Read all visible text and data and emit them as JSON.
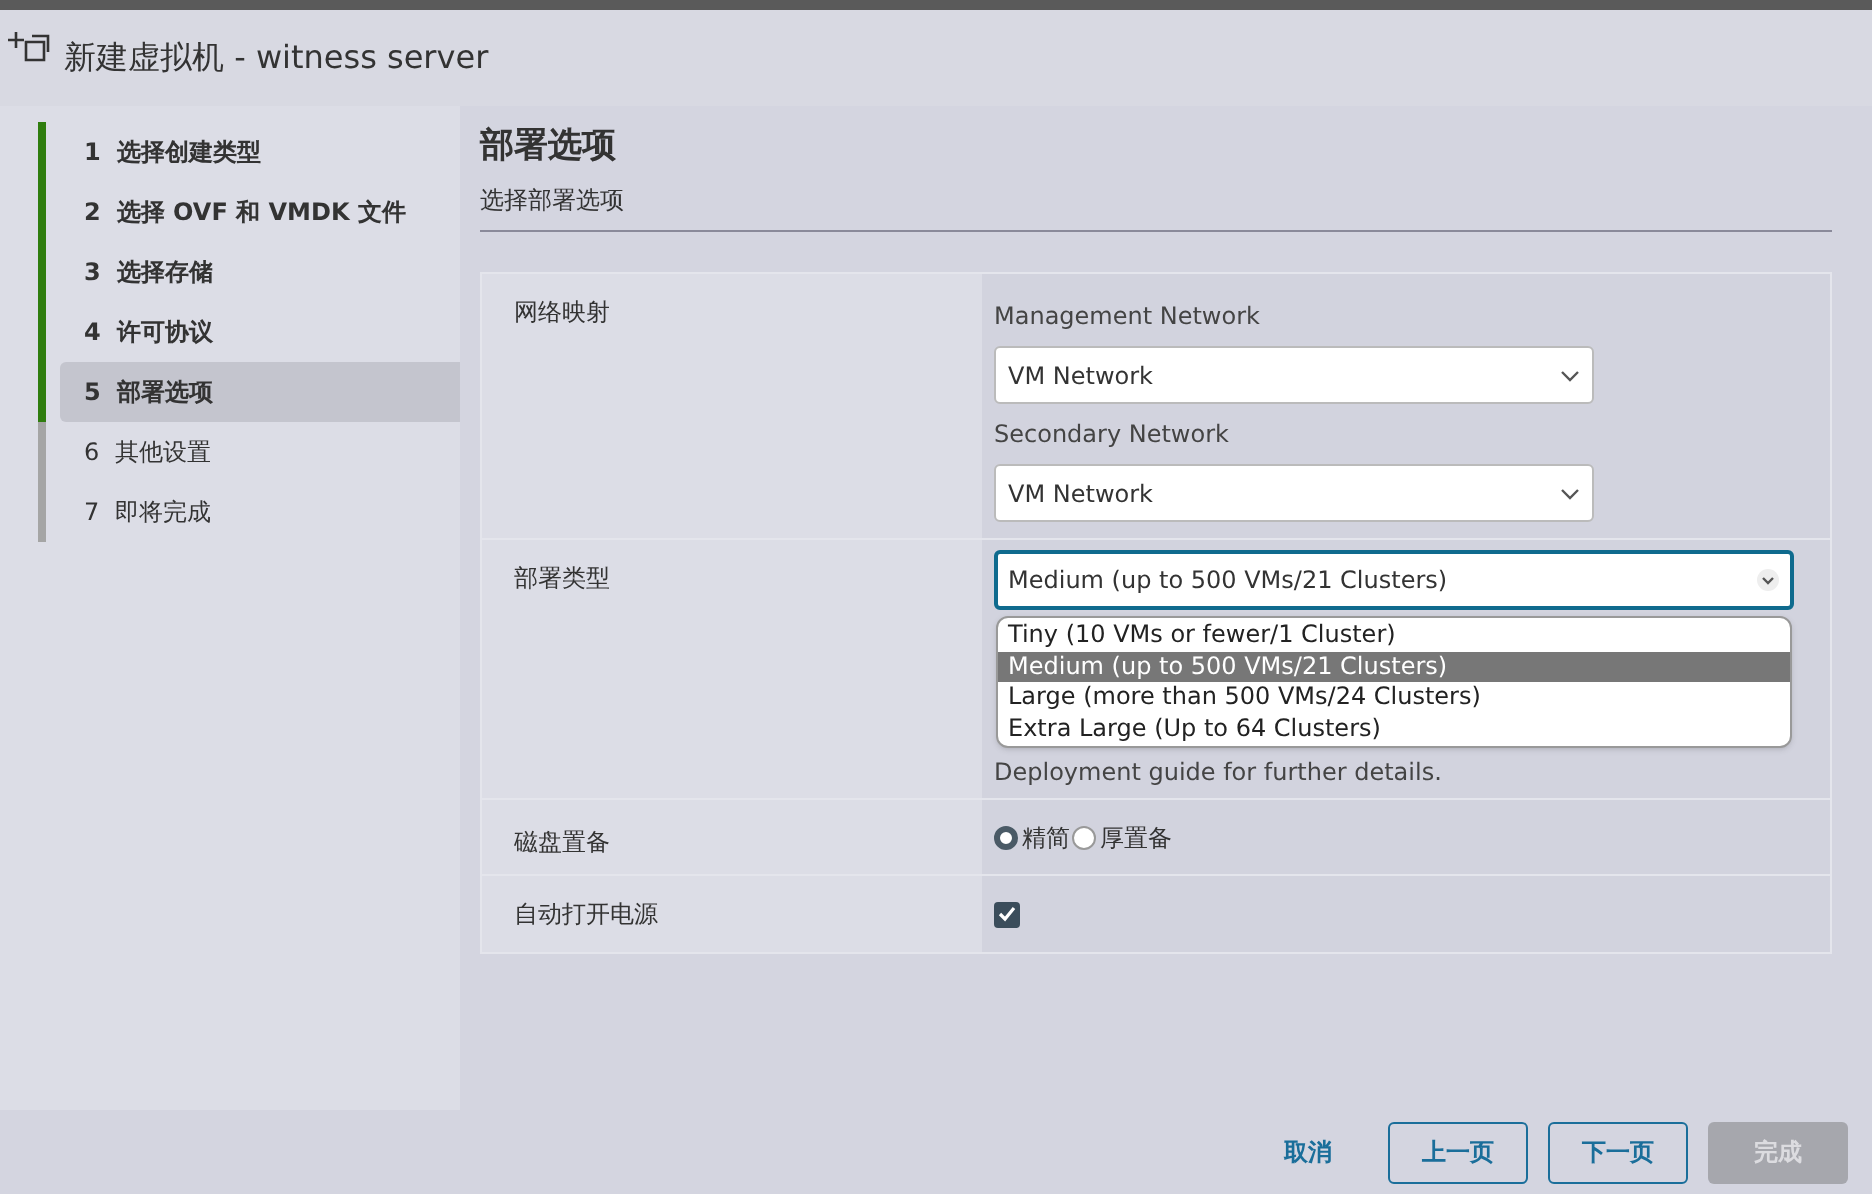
{
  "window": {
    "title": "新建虚拟机 - witness server"
  },
  "steps": [
    {
      "number": "1",
      "label": "选择创建类型",
      "done": true,
      "selected": false
    },
    {
      "number": "2",
      "label": "选择 OVF 和 VMDK 文件",
      "done": true,
      "selected": false
    },
    {
      "number": "3",
      "label": "选择存储",
      "done": true,
      "selected": false
    },
    {
      "number": "4",
      "label": "许可协议",
      "done": true,
      "selected": false
    },
    {
      "number": "5",
      "label": "部署选项",
      "done": true,
      "selected": true
    },
    {
      "number": "6",
      "label": "其他设置",
      "done": false,
      "selected": false
    },
    {
      "number": "7",
      "label": "即将完成",
      "done": false,
      "selected": false
    }
  ],
  "page": {
    "title": "部署选项",
    "subtitle": "选择部署选项"
  },
  "network_mapping": {
    "label": "网络映射",
    "networks": [
      {
        "name": "Management Network",
        "value": "VM Network"
      },
      {
        "name": "Secondary Network",
        "value": "VM Network"
      }
    ]
  },
  "deployment_type": {
    "label": "部署类型",
    "value": "Medium (up to 500 VMs/21 Clusters)",
    "expanded": true,
    "options": [
      {
        "label": "Tiny (10 VMs or fewer/1 Cluster)",
        "selected": false
      },
      {
        "label": "Medium (up to 500 VMs/21 Clusters)",
        "selected": true
      },
      {
        "label": "Large (more than 500 VMs/24 Clusters)",
        "selected": false
      },
      {
        "label": "Extra Large (Up to 64 Clusters)",
        "selected": false
      }
    ],
    "note": "Deployment guide for further details."
  },
  "disk_provisioning": {
    "label": "磁盘置备",
    "options": [
      {
        "label": "精简",
        "selected": true
      },
      {
        "label": "厚置备",
        "selected": false
      }
    ]
  },
  "auto_power_on": {
    "label": "自动打开电源",
    "checked": true
  },
  "buttons": [
    {
      "label": "取消",
      "kind": "link",
      "disabled": false
    },
    {
      "label": "上一页",
      "kind": "outline",
      "disabled": false
    },
    {
      "label": "下一页",
      "kind": "outline",
      "disabled": false
    },
    {
      "label": "完成",
      "kind": "solid",
      "disabled": true
    }
  ]
}
